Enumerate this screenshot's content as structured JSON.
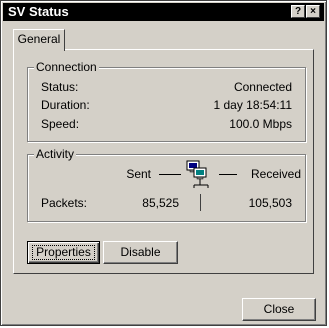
{
  "window": {
    "title": "SV Status",
    "help_glyph": "?",
    "close_glyph": "×"
  },
  "tabs": [
    {
      "label": "General",
      "selected": true
    }
  ],
  "connection": {
    "group_label": "Connection",
    "status_label": "Status:",
    "status_value": "Connected",
    "duration_label": "Duration:",
    "duration_value": "1 day 18:54:11",
    "speed_label": "Speed:",
    "speed_value": "100.0 Mbps"
  },
  "activity": {
    "group_label": "Activity",
    "sent_label": "Sent",
    "received_label": "Received",
    "packets_label": "Packets:",
    "packets_sent": "85,525",
    "packets_received": "105,503",
    "icon": "network-computers-icon"
  },
  "buttons": {
    "properties": "Properties",
    "disable": "Disable",
    "close": "Close"
  },
  "colors": {
    "face": "#d4d0c8",
    "titlebar": "#000000",
    "title_text": "#ffffff"
  }
}
